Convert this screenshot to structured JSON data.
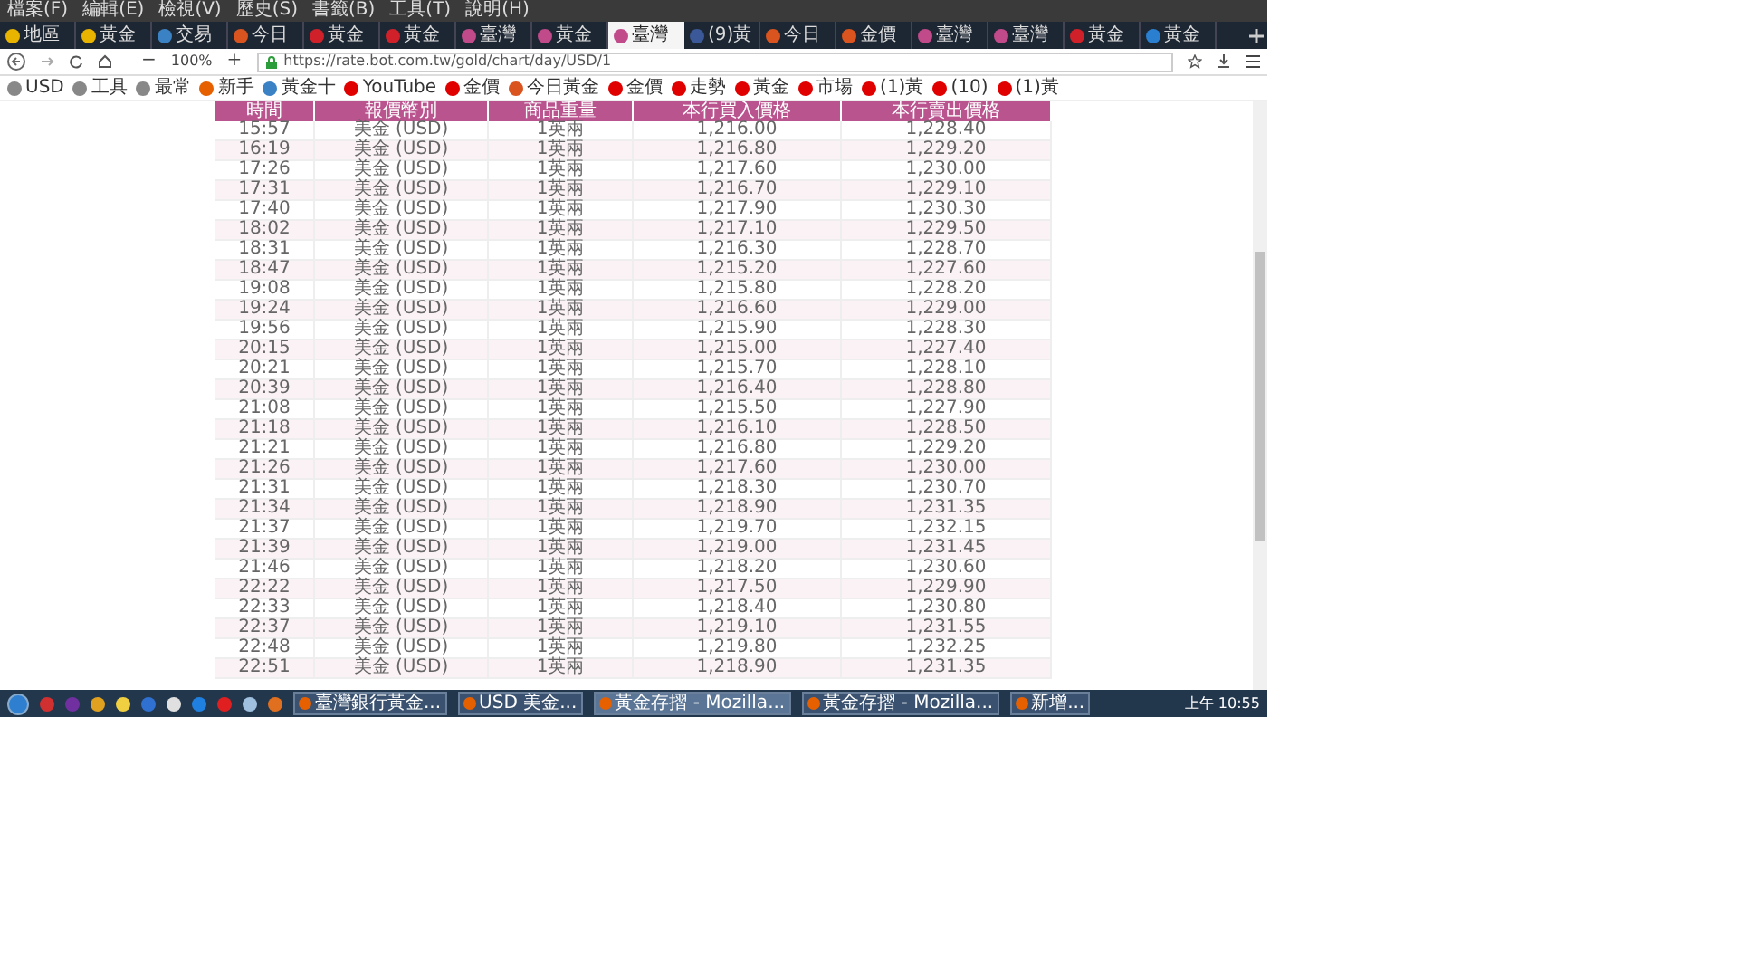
{
  "menu": [
    "檔案(F)",
    "編輯(E)",
    "檢視(V)",
    "歷史(S)",
    "書籤(B)",
    "工具(T)",
    "說明(H)"
  ],
  "tabs": [
    {
      "label": "地區",
      "selected": false,
      "color": "#e8b400"
    },
    {
      "label": "黃金",
      "selected": false,
      "color": "#e8b400"
    },
    {
      "label": "交易",
      "selected": false,
      "color": "#3b82c4"
    },
    {
      "label": "今日",
      "selected": false,
      "color": "#d9541e"
    },
    {
      "label": "黃金",
      "selected": false,
      "color": "#d0202a"
    },
    {
      "label": "黃金",
      "selected": false,
      "color": "#d0202a"
    },
    {
      "label": "臺灣",
      "selected": false,
      "color": "#c04a8a"
    },
    {
      "label": "黃金",
      "selected": false,
      "color": "#c04a8a"
    },
    {
      "label": "臺灣",
      "selected": true,
      "color": "#c04a8a"
    },
    {
      "label": "(9)黃",
      "selected": false,
      "color": "#3b5998"
    },
    {
      "label": "今日",
      "selected": false,
      "color": "#d9541e"
    },
    {
      "label": "金價",
      "selected": false,
      "color": "#d9541e"
    },
    {
      "label": "臺灣",
      "selected": false,
      "color": "#c04a8a"
    },
    {
      "label": "臺灣",
      "selected": false,
      "color": "#c04a8a"
    },
    {
      "label": "黃金",
      "selected": false,
      "color": "#d0202a"
    },
    {
      "label": "黃金",
      "selected": false,
      "color": "#2a7fd0"
    }
  ],
  "zoom_out": "−",
  "zoom": "100%",
  "zoom_in": "+",
  "url": "https://rate.bot.com.tw/gold/chart/day/USD/1",
  "bookmarks": [
    {
      "label": "USD",
      "color": "#888888"
    },
    {
      "label": "工具",
      "color": "#888888"
    },
    {
      "label": "最常",
      "color": "#888888"
    },
    {
      "label": "新手",
      "color": "#e66000"
    },
    {
      "label": "黃金十",
      "color": "#3b82c4"
    },
    {
      "label": "YouTube",
      "color": "#e00000"
    },
    {
      "label": "金價",
      "color": "#e00000"
    },
    {
      "label": "今日黃金",
      "color": "#d9541e"
    },
    {
      "label": "金價",
      "color": "#e00000"
    },
    {
      "label": "走勢",
      "color": "#e00000"
    },
    {
      "label": "黃金",
      "color": "#e00000"
    },
    {
      "label": "市場",
      "color": "#e00000"
    },
    {
      "label": "(1)黃",
      "color": "#e00000"
    },
    {
      "label": "(10)",
      "color": "#e00000"
    },
    {
      "label": "(1)黃",
      "color": "#e00000"
    }
  ],
  "table": {
    "columns": [
      "時間",
      "報價幣別",
      "商品重量",
      "本行買入價格",
      "本行賣出價格"
    ],
    "rows": [
      [
        "15:57",
        "美金 (USD)",
        "1英兩",
        "1,216.00",
        "1,228.40"
      ],
      [
        "16:19",
        "美金 (USD)",
        "1英兩",
        "1,216.80",
        "1,229.20"
      ],
      [
        "17:26",
        "美金 (USD)",
        "1英兩",
        "1,217.60",
        "1,230.00"
      ],
      [
        "17:31",
        "美金 (USD)",
        "1英兩",
        "1,216.70",
        "1,229.10"
      ],
      [
        "17:40",
        "美金 (USD)",
        "1英兩",
        "1,217.90",
        "1,230.30"
      ],
      [
        "18:02",
        "美金 (USD)",
        "1英兩",
        "1,217.10",
        "1,229.50"
      ],
      [
        "18:31",
        "美金 (USD)",
        "1英兩",
        "1,216.30",
        "1,228.70"
      ],
      [
        "18:47",
        "美金 (USD)",
        "1英兩",
        "1,215.20",
        "1,227.60"
      ],
      [
        "19:08",
        "美金 (USD)",
        "1英兩",
        "1,215.80",
        "1,228.20"
      ],
      [
        "19:24",
        "美金 (USD)",
        "1英兩",
        "1,216.60",
        "1,229.00"
      ],
      [
        "19:56",
        "美金 (USD)",
        "1英兩",
        "1,215.90",
        "1,228.30"
      ],
      [
        "20:15",
        "美金 (USD)",
        "1英兩",
        "1,215.00",
        "1,227.40"
      ],
      [
        "20:21",
        "美金 (USD)",
        "1英兩",
        "1,215.70",
        "1,228.10"
      ],
      [
        "20:39",
        "美金 (USD)",
        "1英兩",
        "1,216.40",
        "1,228.80"
      ],
      [
        "21:08",
        "美金 (USD)",
        "1英兩",
        "1,215.50",
        "1,227.90"
      ],
      [
        "21:18",
        "美金 (USD)",
        "1英兩",
        "1,216.10",
        "1,228.50"
      ],
      [
        "21:21",
        "美金 (USD)",
        "1英兩",
        "1,216.80",
        "1,229.20"
      ],
      [
        "21:26",
        "美金 (USD)",
        "1英兩",
        "1,217.60",
        "1,230.00"
      ],
      [
        "21:31",
        "美金 (USD)",
        "1英兩",
        "1,218.30",
        "1,230.70"
      ],
      [
        "21:34",
        "美金 (USD)",
        "1英兩",
        "1,218.90",
        "1,231.35"
      ],
      [
        "21:37",
        "美金 (USD)",
        "1英兩",
        "1,219.70",
        "1,232.15"
      ],
      [
        "21:39",
        "美金 (USD)",
        "1英兩",
        "1,219.00",
        "1,231.45"
      ],
      [
        "21:46",
        "美金 (USD)",
        "1英兩",
        "1,218.20",
        "1,230.60"
      ],
      [
        "22:22",
        "美金 (USD)",
        "1英兩",
        "1,217.50",
        "1,229.90"
      ],
      [
        "22:33",
        "美金 (USD)",
        "1英兩",
        "1,218.40",
        "1,230.80"
      ],
      [
        "22:37",
        "美金 (USD)",
        "1英兩",
        "1,219.10",
        "1,231.55"
      ],
      [
        "22:48",
        "美金 (USD)",
        "1英兩",
        "1,219.80",
        "1,232.25"
      ],
      [
        "22:51",
        "美金 (USD)",
        "1英兩",
        "1,218.90",
        "1,231.35"
      ]
    ]
  },
  "taskbar": {
    "windows": [
      {
        "label": "臺灣銀行黃金...",
        "selected": false
      },
      {
        "label": "USD 美金...",
        "selected": false
      },
      {
        "label": "黃金存摺 - Mozilla...",
        "selected": true
      },
      {
        "label": "黃金存摺 - Mozilla...",
        "selected": false
      },
      {
        "label": "新增...",
        "selected": false
      }
    ],
    "clock": "上午 10:55"
  }
}
